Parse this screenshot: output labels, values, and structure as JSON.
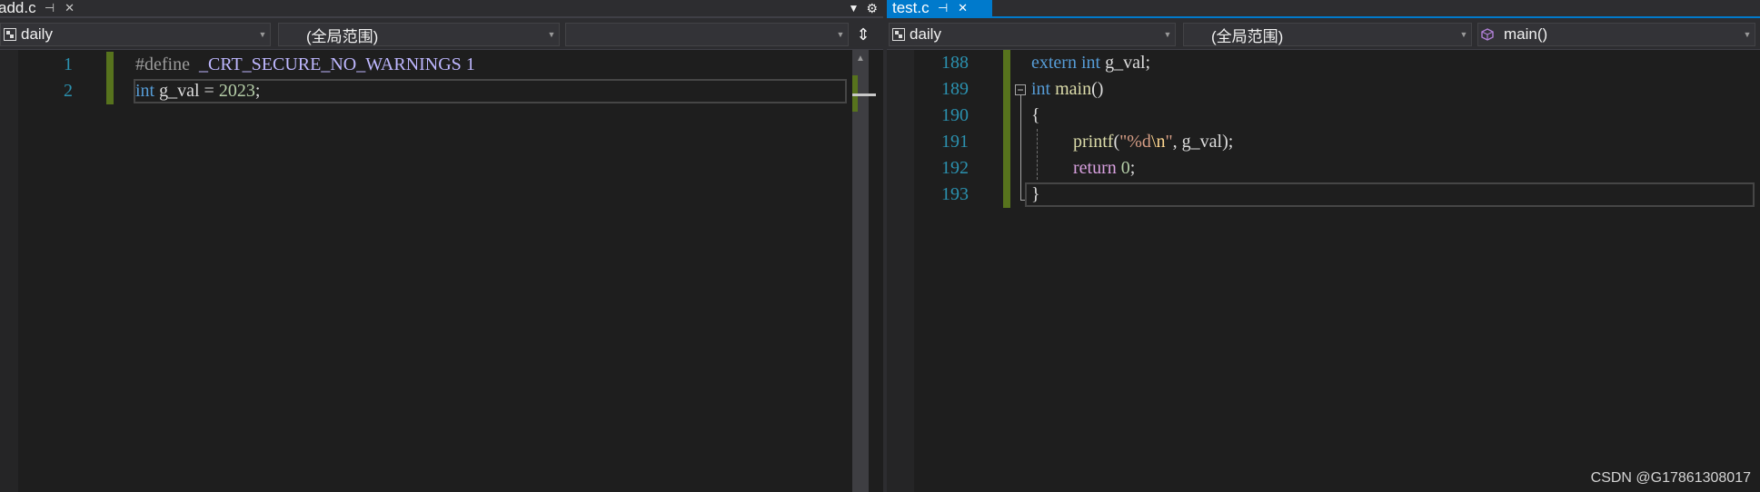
{
  "left_pane": {
    "tab": {
      "name": "add.c",
      "pin_glyph": "⊣",
      "close_glyph": "✕"
    },
    "tab_strip_controls": {
      "dropdown_glyph": "▼",
      "settings_glyph": "⚙"
    },
    "nav": {
      "project": "daily",
      "scope": "(全局范围)",
      "member": ""
    },
    "line_numbers": [
      "1",
      "2"
    ],
    "code": {
      "line1": {
        "directive": "#define",
        "macro": "_CRT_SECURE_NO_WARNINGS",
        "value": "1"
      },
      "line2": {
        "type": "int",
        "decl": " g_val = ",
        "value": "2023",
        "end": ";"
      }
    },
    "split_glyph": "⇕",
    "scroll_up_glyph": "▲"
  },
  "right_pane": {
    "tab": {
      "name": "test.c",
      "pin_glyph": "⊣",
      "close_glyph": "✕"
    },
    "nav": {
      "project": "daily",
      "scope": "(全局范围)",
      "member": "main()"
    },
    "line_numbers": [
      "188",
      "189",
      "190",
      "191",
      "192",
      "193"
    ],
    "code": {
      "l188": {
        "kw1": "extern",
        "kw2": "int",
        "rest": " g_val;"
      },
      "l189": {
        "type": "int",
        "fn": "main",
        "rest": "()"
      },
      "l190": {
        "brace": "{"
      },
      "l191": {
        "fn": "printf",
        "open": "(",
        "str_a": "\"%d",
        "esc": "\\n",
        "str_b": "\"",
        "rest": ", g_val);"
      },
      "l192": {
        "kw": "return",
        "num": "0",
        "end": ";"
      },
      "l193": {
        "brace": "}"
      }
    },
    "fold_glyph": "−"
  },
  "watermark": "CSDN @G17861308017",
  "colors": {
    "background": "#1e1e1e",
    "accent": "#007acc",
    "line_number": "#2b91af",
    "keyword": "#569cd6",
    "change_marker": "#57731d"
  }
}
